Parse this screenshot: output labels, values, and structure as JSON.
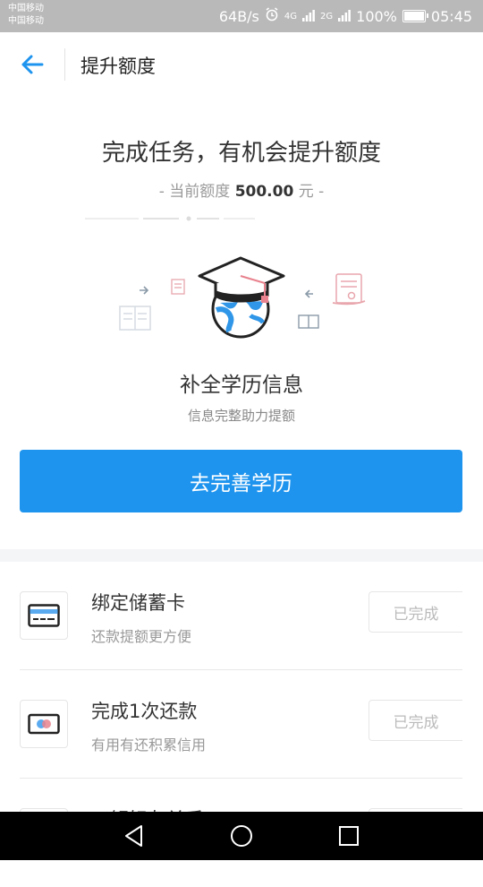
{
  "status_bar": {
    "carrier1": "中国移动",
    "carrier2": "中国移动",
    "speed": "64B/s",
    "sig1": "4G",
    "sig2": "2G",
    "battery": "100%",
    "battery_level": 1.0,
    "time": "05:45"
  },
  "header": {
    "back_icon": "arrow-left-icon",
    "title": "提升额度",
    "accent": "#1e94ee"
  },
  "hero": {
    "headline": "完成任务，有机会提升额度",
    "quota_prefix": "- 当前额度",
    "quota_amount": "500.00",
    "quota_suffix": "元 -"
  },
  "current_task": {
    "illustration": "graduation-cap-globe-illustration",
    "title": "补全学历信息",
    "subtitle": "信息完整助力提额",
    "button": "去完善学历"
  },
  "tasks": [
    {
      "icon": "bank-card-icon",
      "name": "绑定储蓄卡",
      "desc": "还款提额更方便",
      "status": "已完成"
    },
    {
      "icon": "repayment-icon",
      "name": "完成1次还款",
      "desc": "有用有还积累信用",
      "status": "已完成"
    },
    {
      "icon": "friends-icon",
      "name": "了解好友关系",
      "desc": "",
      "status": ""
    }
  ],
  "nav": {
    "back": "nav-back-icon",
    "home": "nav-home-icon",
    "recents": "nav-recents-icon"
  }
}
